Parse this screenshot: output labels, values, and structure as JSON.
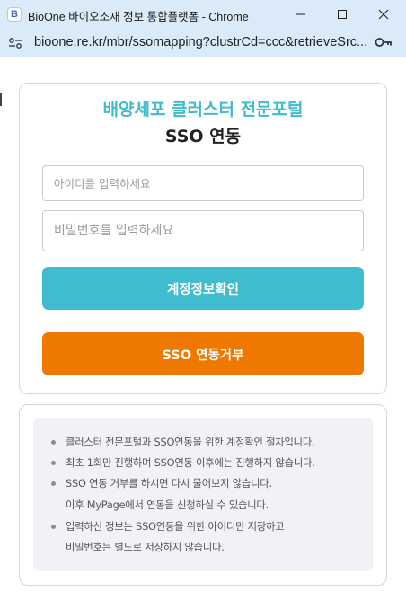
{
  "window": {
    "title": "BioOne 바이오소재 정보 통합플랫폼 - Chrome",
    "app_icon_letter": "B",
    "url": "bioone.re.kr/mbr/ssomapping?clustrCd=ccc&retrieveSrc..."
  },
  "page": {
    "portal_title": "배양세포 클러스터 전문포털",
    "sso_title": "SSO 연동",
    "id_placeholder": "아이디를 입력하세요",
    "pw_placeholder": "비밀번호를 입력하세요",
    "confirm_button": "계정정보확인",
    "refuse_button": "SSO 연동거부"
  },
  "notice": {
    "items": [
      "클러스터 전문포털과 SSO연동을 위한 계정확인 절차입니다.",
      "최초 1회만 진행하며 SSO연동 이후에는 진행하지 않습니다.",
      "SSO 연동 거부를 하시면 다시 물어보지 않습니다.",
      "이후 MyPage에서 연동을 신청하실 수 있습니다.",
      "입력하신 정보는 SSO연동을 위한 아이디만 저장하고",
      "비밀번호는 별도로 저장하지 않습니다."
    ]
  },
  "colors": {
    "accent_teal": "#3fbccd",
    "accent_orange": "#ee7800",
    "chrome_bar": "#dbeaf8"
  },
  "icons": [
    "app-icon",
    "minimize-icon",
    "maximize-icon",
    "close-icon",
    "site-info-icon",
    "key-icon"
  ]
}
